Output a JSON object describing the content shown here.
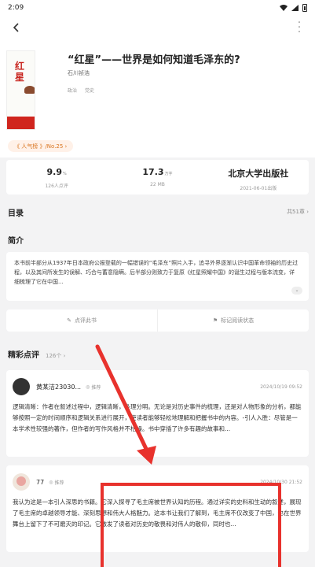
{
  "status_bar": {
    "time": "2:09"
  },
  "top_bar": {
    "back_icon": "back-arrow-icon",
    "more_icon": "more-vertical-icon"
  },
  "book": {
    "title": "“红星”——世界是如何知道毛泽东的?",
    "author": "石川祯浩",
    "tags": [
      "政治",
      "党史"
    ],
    "cover_title": "红星",
    "rank_badge": "《 人气榜 》/No.25 ›"
  },
  "stats": [
    {
      "value": "9.9",
      "unit": "%",
      "label": "126人点评"
    },
    {
      "value": "17.3",
      "unit": "万字",
      "label": "22 MB"
    },
    {
      "value": "北京大学出版社",
      "unit": "",
      "label": "2021-06-01出版"
    }
  ],
  "toc": {
    "label": "目录",
    "count": "共51章 ›"
  },
  "intro": {
    "title": "简介",
    "text": "本书前半部分从1937年日本政府公报登载的一幅错误的“毛泽东”照片入手，追寻外界逐渐认识中国革命领袖的历史过程，以及其间所发生的误解、巧合与蓄意隐瞒。后半部分则致力于复原《红星照耀中国》的诞生过程与版本流变，详细梳理了它在中国...",
    "expand_icon": "chevron-down-icon"
  },
  "actions": [
    {
      "label": "点评此书",
      "icon": "pencil-icon"
    },
    {
      "label": "标记阅读状态",
      "icon": "flag-icon"
    }
  ],
  "reviews_section": {
    "title": "精彩点评",
    "count": "126个 ›"
  },
  "reviews": [
    {
      "name": "黄某洁23030...",
      "recommend": "推荐",
      "date": "2024/10/19 09:52",
      "text": "逻辑清晰：作者在叙述过程中，逻辑清晰，条理分明。无论是对历史事件的梳理，还是对人物形象的分析，都能够按照一定的时间顺序和逻辑关系进行展开，使读者能够轻松地理解和把握书中的内容。-引人入胜：尽管是一本学术性较强的著作，但作者的写作风格并不枯燥。书中穿插了许多有趣的故事和..."
    },
    {
      "name": "77",
      "recommend": "推荐",
      "date": "2024/10/30 21:52",
      "text": "我认为这是一本引人深思的书籍。它深入探寻了毛主席被世界认知的历程。通过详实的史料和生动的叙述，展现了毛主席的卓越领导才能、深刻思想和伟大人格魅力。这本书让我们了解到，毛主席不仅改变了中国，也在世界舞台上留下了不可磨灭的印记。它激发了读者对历史的敬畏和对伟人的敬仰，同时也..."
    }
  ],
  "colors": {
    "accent_red": "#d0251e",
    "annotation_red": "#e8322d",
    "badge_orange": "#d9751f"
  }
}
